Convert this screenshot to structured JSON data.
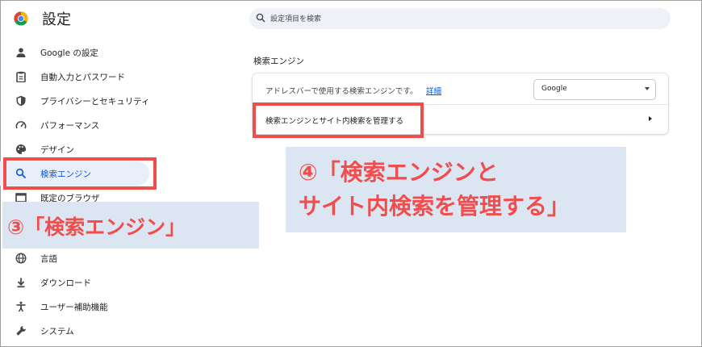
{
  "app": {
    "title": "設定"
  },
  "search": {
    "placeholder": "設定項目を検索"
  },
  "sidebar": {
    "items": [
      {
        "label": "Google の設定",
        "icon": "person-icon"
      },
      {
        "label": "自動入力とパスワード",
        "icon": "clipboard-icon"
      },
      {
        "label": "プライバシーとセキュリティ",
        "icon": "shield-icon"
      },
      {
        "label": "パフォーマンス",
        "icon": "speedometer-icon"
      },
      {
        "label": "デザイン",
        "icon": "palette-icon"
      },
      {
        "label": "検索エンジン",
        "icon": "search-icon",
        "active": true
      },
      {
        "label": "既定のブラウザ",
        "icon": "browser-icon"
      },
      {
        "label": "言語",
        "icon": "globe-icon"
      },
      {
        "label": "ダウンロード",
        "icon": "download-icon"
      },
      {
        "label": "ユーザー補助機能",
        "icon": "accessibility-icon"
      },
      {
        "label": "システム",
        "icon": "wrench-icon"
      }
    ]
  },
  "main": {
    "section_title": "検索エンジン",
    "address_bar_text": "アドレスバーで使用する検索エンジンです。",
    "detail_link": "詳細",
    "engine_select": "Google",
    "manage_label": "検索エンジンとサイト内検索を管理する"
  },
  "annotations": {
    "callout3": "③「検索エンジン」",
    "callout4_line1": "④「検索エンジンと",
    "callout4_line2": "サイト内検索を管理する」"
  },
  "colors": {
    "accent": "#0b57d0",
    "highlight": "#f04d4d",
    "callout_bg": "#dce6f2",
    "active_bg": "#e8eefa"
  }
}
